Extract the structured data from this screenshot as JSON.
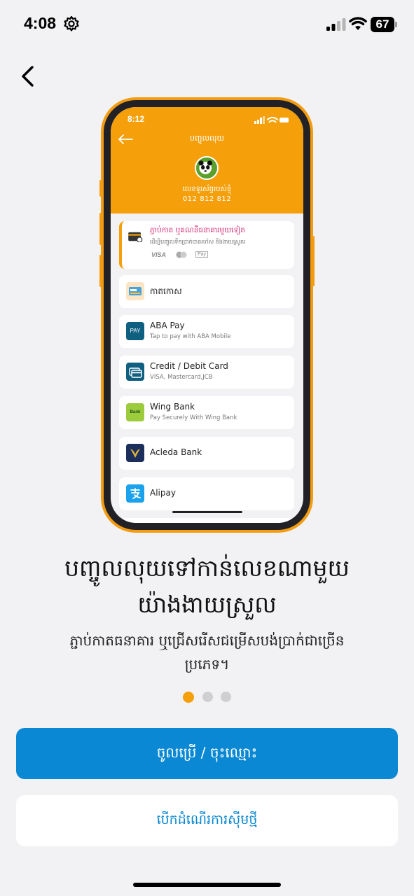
{
  "status_bar": {
    "time": "4:08",
    "battery": "67"
  },
  "phone_mockup": {
    "time": "8:12",
    "header_title": "បញ្ចូលលុយ",
    "account_label": "លេខទូរស័ព្ទរបស់ខ្ញុំ",
    "phone_number": "012 812 812",
    "link_card": {
      "title": "ភ្ជាប់កាត ឬគណនីធនាគារមួយទៀត",
      "subtitle": "ដើម្បីបញ្ចូលទឹកប្រាក់បានរហ័ស និងងាយស្រួល",
      "brands": [
        "VISA",
        "Pay"
      ]
    },
    "methods": [
      {
        "title": "កាតកោស",
        "subtitle": ""
      },
      {
        "title": "ABA Pay",
        "subtitle": "Tap to pay with ABA Mobile",
        "icon_text": "PAY"
      },
      {
        "title": "Credit / Debit Card",
        "subtitle": "VISA, Mastercard,JCB"
      },
      {
        "title": "Wing Bank",
        "subtitle": "Pay Securely With Wing Bank",
        "icon_text": "Bank"
      },
      {
        "title": "Acleda Bank",
        "subtitle": ""
      },
      {
        "title": "Alipay",
        "subtitle": ""
      }
    ]
  },
  "onboarding": {
    "headline_line1": "បញ្ចូលលុយទៅកាន់លេខណាមួយ",
    "headline_line2": "យ៉ាងងាយស្រួល",
    "subtitle_line1": "ភ្ជាប់កាតធនាគារ ឬជ្រើសរើសជម្រើសបង់ប្រាក់ជាច្រើន",
    "subtitle_line2": "ប្រភេទ។",
    "pagination": {
      "current": 1,
      "total": 3
    }
  },
  "buttons": {
    "primary": "ចូលប្រើ / ចុះឈ្មោះ",
    "secondary": "បើកដំណើរការស៊ីមថ្មី"
  },
  "colors": {
    "accent_orange": "#f5a00a",
    "primary_blue": "#0a88d3",
    "dot_inactive": "#cfcfd2",
    "link_card_pink": "#d6337a"
  }
}
